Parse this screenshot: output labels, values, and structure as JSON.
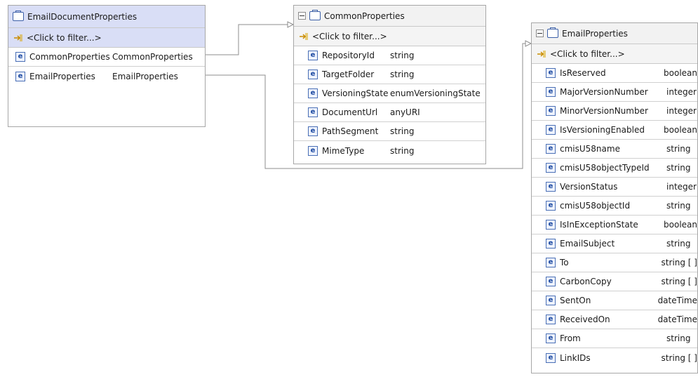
{
  "filter_label": "<Click to filter...>",
  "boxes": {
    "email_document": {
      "title": "EmailDocumentProperties",
      "rows": [
        {
          "name": "CommonProperties",
          "type": "CommonProperties"
        },
        {
          "name": "EmailProperties",
          "type": "EmailProperties"
        }
      ]
    },
    "common": {
      "title": "CommonProperties",
      "rows": [
        {
          "name": "RepositoryId",
          "type": "string"
        },
        {
          "name": "TargetFolder",
          "type": "string"
        },
        {
          "name": "VersioningState",
          "type": "enumVersioningState"
        },
        {
          "name": "DocumentUrl",
          "type": "anyURI"
        },
        {
          "name": "PathSegment",
          "type": "string"
        },
        {
          "name": "MimeType",
          "type": "string"
        }
      ]
    },
    "email": {
      "title": "EmailProperties",
      "rows": [
        {
          "name": "IsReserved",
          "type": "boolean"
        },
        {
          "name": "MajorVersionNumber",
          "type": "integer"
        },
        {
          "name": "MinorVersionNumber",
          "type": "integer"
        },
        {
          "name": "IsVersioningEnabled",
          "type": "boolean"
        },
        {
          "name": "cmisU58name",
          "type": "string"
        },
        {
          "name": "cmisU58objectTypeId",
          "type": "string"
        },
        {
          "name": "VersionStatus",
          "type": "integer"
        },
        {
          "name": "cmisU58objectId",
          "type": "string"
        },
        {
          "name": "IsInExceptionState",
          "type": "boolean"
        },
        {
          "name": "EmailSubject",
          "type": "string"
        },
        {
          "name": "To",
          "type": "string [ ]"
        },
        {
          "name": "CarbonCopy",
          "type": "string [ ]"
        },
        {
          "name": "SentOn",
          "type": "dateTime"
        },
        {
          "name": "ReceivedOn",
          "type": "dateTime"
        },
        {
          "name": "From",
          "type": "string"
        },
        {
          "name": "LinkIDs",
          "type": "string [ ]"
        }
      ]
    }
  },
  "icon_names": [
    "business-object-icon",
    "filter-icon",
    "element-icon",
    "collapse-icon"
  ],
  "colors": {
    "selected_header": "#d9def6",
    "border": "#a7a7a7",
    "element_icon": "#1d4aa0",
    "connector": "#8c8c8c"
  }
}
